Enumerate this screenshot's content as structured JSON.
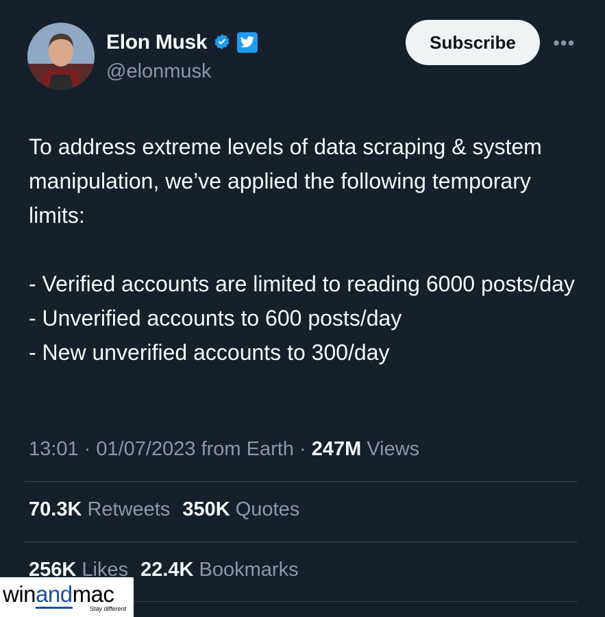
{
  "author": {
    "name": "Elon Musk",
    "handle": "@elonmusk",
    "avatar_icon": "profile-photo",
    "verified_icon": "verified-badge-icon",
    "affiliate_icon": "twitter-bird-icon",
    "verified_color": "#1d9bf0"
  },
  "actions": {
    "subscribe_label": "Subscribe",
    "more_label": "•••"
  },
  "tweet": {
    "lines": [
      "To address extreme levels of data scraping & system manipulation, we’ve applied the following temporary limits:",
      "- Verified accounts are limited to reading 6000 posts/day",
      "- Unverified accounts to 600 posts/day",
      "- New unverified accounts to 300/day"
    ]
  },
  "meta": {
    "time": "13:01",
    "sep1": " · ",
    "date": "01/07/2023",
    "location": " from Earth",
    "sep2": " · ",
    "views_count": "247M",
    "views_label": " Views"
  },
  "stats": {
    "retweets_count": "70.3K",
    "retweets_label": " Retweets",
    "quotes_count": "350K",
    "quotes_label": " Quotes",
    "likes_count": "256K",
    "likes_label": " Likes",
    "bookmarks_count": "22.4K",
    "bookmarks_label": " Bookmarks"
  },
  "watermark": {
    "win": "win",
    "and": "and",
    "mac": "mac",
    "tagline": "Stay different"
  },
  "colors": {
    "background": "#15202b",
    "text_primary": "#f7f9f9",
    "text_secondary": "#8b98a5",
    "divider": "#38444d"
  }
}
